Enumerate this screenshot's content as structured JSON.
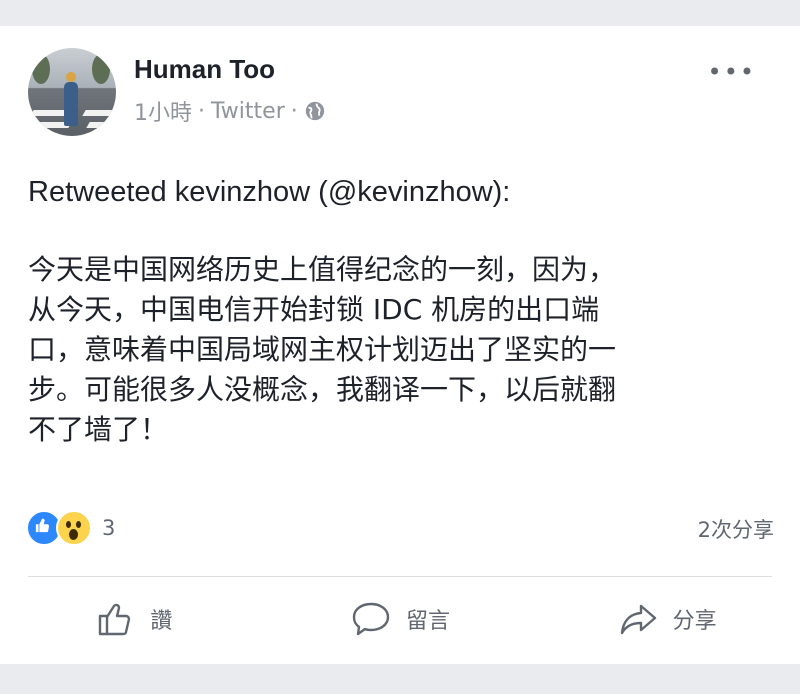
{
  "post": {
    "author": "Human Too",
    "time": "1小時",
    "separator": "·",
    "source": "Twitter",
    "retweet_line": "Retweeted kevinzhow (@kevinzhow):",
    "body": "今天是中国网络历史上值得纪念的一刻，因为，\n从今天，中国电信开始封锁 IDC 机房的出口端\n口，意味着中国局域网主权计划迈出了坚实的一\n步。可能很多人没概念，我翻译一下，以后就翻\n不了墙了！",
    "more_label": "•••"
  },
  "stats": {
    "reaction_count": "3",
    "shares": "2次分享",
    "reaction_icons": [
      "like-icon",
      "wow-icon"
    ]
  },
  "actions": {
    "like": "讚",
    "comment": "留言",
    "share": "分享"
  },
  "colors": {
    "accent": "#2d88ff",
    "muted_text": "#90949c",
    "background": "#e9ebee"
  }
}
